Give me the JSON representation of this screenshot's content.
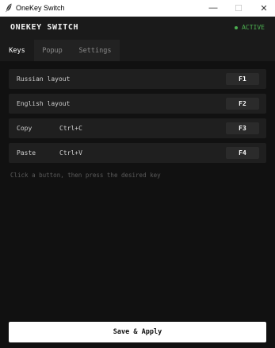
{
  "window": {
    "title": "OneKey Switch",
    "minimize_glyph": "—",
    "maximize_glyph": "☐",
    "close_glyph": "✕"
  },
  "header": {
    "brand": "ONEKEY SWITCH",
    "status": "ACTIVE",
    "status_color": "#4caf50"
  },
  "tabs": [
    {
      "label": "Keys",
      "active": true
    },
    {
      "label": "Popup",
      "active": false
    },
    {
      "label": "Settings",
      "active": false
    }
  ],
  "bindings": [
    {
      "action": "Russian layout",
      "combo": "",
      "key": "F1"
    },
    {
      "action": "English layout",
      "combo": "",
      "key": "F2"
    },
    {
      "action": "Copy",
      "combo": "Ctrl+C",
      "key": "F3"
    },
    {
      "action": "Paste",
      "combo": "Ctrl+V",
      "key": "F4"
    }
  ],
  "hint": "Click a button, then press the desired key",
  "footer": {
    "save_label": "Save & Apply"
  }
}
